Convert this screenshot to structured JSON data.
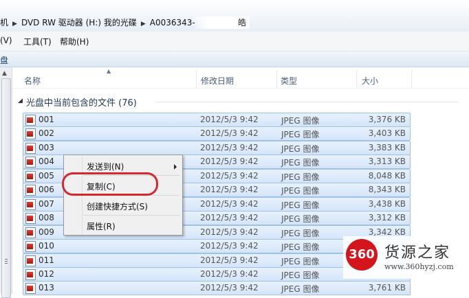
{
  "address": {
    "segments": [
      "机",
      "DVD RW 驱动器 (H:) 我的光碟",
      "A0036343-"
    ],
    "tail": "皓"
  },
  "menu": [
    "(V)",
    "工具(T)",
    "帮助(H)"
  ],
  "cmdbar": {
    "label": "盘"
  },
  "columns": {
    "name": "名称",
    "date": "修改日期",
    "type": "类型",
    "size": "大小"
  },
  "group": {
    "title": "光盘中当前包含的文件 (76)"
  },
  "files": [
    {
      "name": "001",
      "date": "2012/5/3 9:42",
      "type": "JPEG 图像",
      "size": "3,376 KB"
    },
    {
      "name": "002",
      "date": "2012/5/3 9:42",
      "type": "JPEG 图像",
      "size": "3,403 KB"
    },
    {
      "name": "003",
      "date": "2012/5/3 9:42",
      "type": "JPEG 图像",
      "size": "3,383 KB"
    },
    {
      "name": "004",
      "date": "2012/5/3 9:42",
      "type": "JPEG 图像",
      "size": "3,313 KB"
    },
    {
      "name": "005",
      "date": "2012/5/3 9:42",
      "type": "JPEG 图像",
      "size": "8,048 KB"
    },
    {
      "name": "006",
      "date": "2012/5/3 9:42",
      "type": "JPEG 图像",
      "size": "8,343 KB"
    },
    {
      "name": "007",
      "date": "2012/5/3 9:42",
      "type": "JPEG 图像",
      "size": "3,438 KB"
    },
    {
      "name": "008",
      "date": "2012/5/3 9:42",
      "type": "JPEG 图像",
      "size": "3,312 KB"
    },
    {
      "name": "009",
      "date": "2012/5/3 9:42",
      "type": "JPEG 图像",
      "size": "3,342 KB"
    },
    {
      "name": "010",
      "date": "2012/5/3 9:42",
      "type": "JPEG 图像",
      "size": ""
    },
    {
      "name": "011",
      "date": "2012/5/3 9:42",
      "type": "JPEG 图像",
      "size": ""
    },
    {
      "name": "012",
      "date": "2012/5/3 9:42",
      "type": "JPEG 图像",
      "size": ""
    },
    {
      "name": "013",
      "date": "2012/5/3 9:42",
      "type": "JPEG 图像",
      "size": "3,761 KB"
    }
  ],
  "context_menu": {
    "send_to": "发送到(N)",
    "copy": "复制(C)",
    "shortcut": "创建快捷方式(S)",
    "properties": "属性(R)"
  },
  "watermark": {
    "logo": "360",
    "title": "货源之家",
    "url": "www.360hyzj.com"
  },
  "colors": {
    "selection": "#d4e5fa",
    "selection_border": "#9ec1ea",
    "highlight": "#d9262d",
    "brand": "#d4161c"
  }
}
